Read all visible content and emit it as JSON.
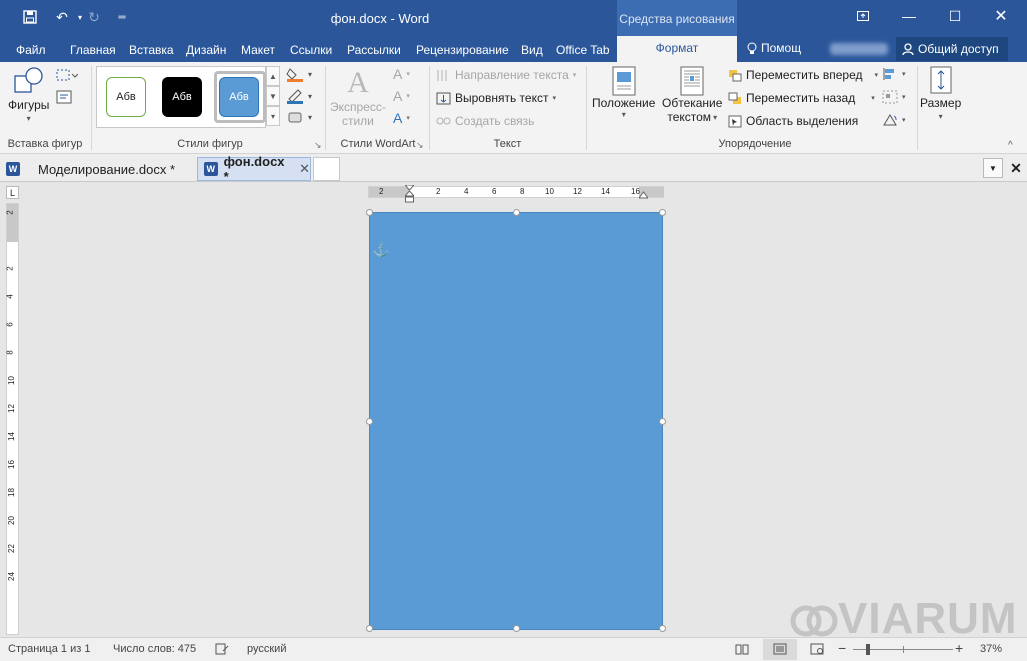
{
  "title": "фон.docx - Word",
  "context_title": "Средства рисования",
  "tabs": [
    "Файл",
    "Главная",
    "Вставка",
    "Дизайн",
    "Макет",
    "Ссылки",
    "Рассылки",
    "Рецензирование",
    "Вид",
    "Office Tab"
  ],
  "active_tab": "Формат",
  "tell_me": "Помощ",
  "share": "Общий доступ",
  "ribbon": {
    "insert_shapes": {
      "shapes_label": "Фигуры",
      "group": "Вставка фигур"
    },
    "shape_styles": {
      "samples": [
        "Абв",
        "Абв",
        "Абв"
      ],
      "group": "Стили фигур"
    },
    "wordart": {
      "quick_styles_line1": "Экспресс-",
      "quick_styles_line2": "стили",
      "group": "Стили WordArt"
    },
    "text": {
      "direction": "Направление текста",
      "align": "Выровнять текст",
      "link": "Создать связь",
      "group": "Текст"
    },
    "arrange": {
      "position": "Положение",
      "wrap_line1": "Обтекание",
      "wrap_line2": "текстом",
      "forward": "Переместить вперед",
      "backward": "Переместить назад",
      "selection": "Область выделения",
      "group": "Упорядочение"
    },
    "size": {
      "label": "Размер"
    }
  },
  "doc_tabs": [
    "Моделирование.docx *",
    "фон.docx *"
  ],
  "hruler_ticks": [
    "2",
    "2",
    "4",
    "6",
    "8",
    "10",
    "12",
    "14",
    "16"
  ],
  "vruler_ticks": [
    "2",
    "2",
    "4",
    "6",
    "8",
    "10",
    "12",
    "14",
    "16",
    "18",
    "20",
    "22",
    "24"
  ],
  "status": {
    "page": "Страница 1 из 1",
    "words": "Число слов: 475",
    "language": "русский",
    "zoom": "37%"
  },
  "watermark": "VIARUM",
  "colors": {
    "accent": "#2b579a",
    "shape_fill": "#5b9bd5"
  }
}
